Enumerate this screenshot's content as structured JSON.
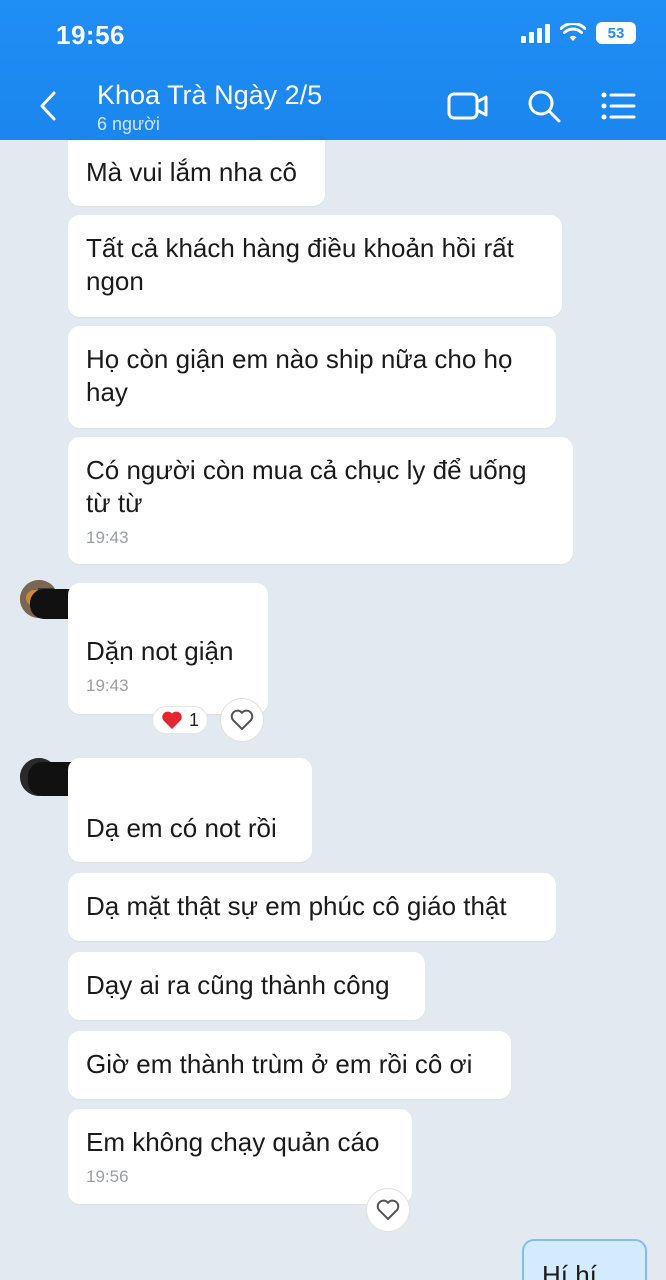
{
  "status_bar": {
    "time": "19:56",
    "battery": "53"
  },
  "header": {
    "title": "Khoa Trà Ngày 2/5",
    "subtitle": "6 người"
  },
  "messages": [
    {
      "text": "Mà vui lắm nha cô"
    },
    {
      "text": "Tất cả khách hàng điều khoản hồi rất ngon"
    },
    {
      "text": "Họ còn giận em nào ship nữa cho họ hay"
    },
    {
      "text": "Có người còn mua cả chục ly để uống từ từ",
      "time": "19:43"
    },
    {
      "text": "Dặn not giận",
      "time": "19:43",
      "reaction_count": "1"
    },
    {
      "text": "Dạ em có not rồi"
    },
    {
      "text": "Dạ mặt thật sự em phúc cô giáo thật"
    },
    {
      "text": "Dạy ai ra cũng thành công"
    },
    {
      "text": "Giờ em thành trùm ở em rồi cô ơi"
    },
    {
      "text": "Em không chạy quản cáo",
      "time": "19:56"
    },
    {
      "text": "Hí hí"
    }
  ]
}
